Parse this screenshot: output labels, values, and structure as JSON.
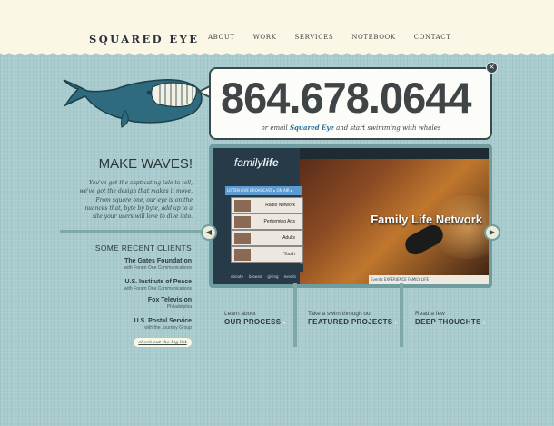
{
  "header": {
    "logo": "SQUARED EYE",
    "nav": [
      "ABOUT",
      "WORK",
      "SERVICES",
      "NOTEBOOK",
      "CONTACT"
    ]
  },
  "contact": {
    "phone": "864.678.0644",
    "email_prefix": "or email ",
    "email_brand": "Squared Eye",
    "email_suffix": " and start swimming with whales",
    "close": "×"
  },
  "intro": {
    "title": "MAKE WAVES!",
    "body": "You've got the captivating tale to tell, we've got the design that makes it move. From square one, our eye is on the nuances that, byte by byte, add up to a site your users will love to dive into."
  },
  "clients": {
    "title": "SOME RECENT CLIENTS",
    "items": [
      {
        "name": "The Gates Foundation",
        "sub": "with Forum One Communications"
      },
      {
        "name": "U.S. Institute of Peace",
        "sub": "with Forum One Communications"
      },
      {
        "name": "Fox Television",
        "sub": "Philadelphia"
      },
      {
        "name": "U.S. Postal Service",
        "sub": "with the Journey Group"
      }
    ],
    "big_list": "check out the big list"
  },
  "slider": {
    "prev": "◀",
    "next": "▶",
    "site_logo_a": "family",
    "site_logo_b": "life",
    "tabs": "LISTEN LIVE   BROADCAST ▸   ON AIR   ▸",
    "menu": [
      "Radio Network",
      "Performing Arts",
      "Adults",
      "Youth"
    ],
    "bottom_bar": [
      "donate",
      "browse",
      "giving",
      "events"
    ],
    "caption": "Family Life Network",
    "events": "Events    EXPERIENCE FAMILY LIFE"
  },
  "features": [
    {
      "small": "Learn about",
      "big": "OUR PROCESS"
    },
    {
      "small": "Take a swim through our",
      "big": "FEATURED PROJECTS"
    },
    {
      "small": "Read a few",
      "big": "DEEP THOUGHTS"
    }
  ],
  "colors": {
    "background": "#a9cccf",
    "header": "#fbf7e6",
    "whale": "#2e6b7e",
    "brand_link": "#2a6f9a"
  }
}
